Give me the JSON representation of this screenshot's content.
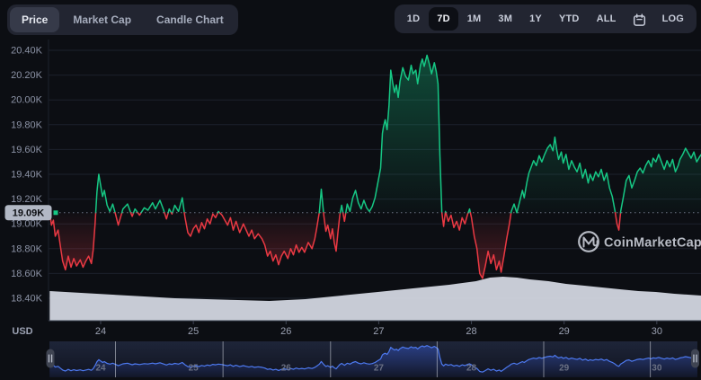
{
  "header": {
    "chart_tabs": [
      {
        "label": "Price",
        "active": true
      },
      {
        "label": "Market Cap",
        "active": false
      },
      {
        "label": "Candle Chart",
        "active": false
      }
    ],
    "range_buttons": [
      {
        "label": "1D",
        "active": false
      },
      {
        "label": "7D",
        "active": true
      },
      {
        "label": "1M",
        "active": false
      },
      {
        "label": "3M",
        "active": false
      },
      {
        "label": "1Y",
        "active": false
      },
      {
        "label": "YTD",
        "active": false
      },
      {
        "label": "ALL",
        "active": false
      }
    ],
    "log_label": "LOG"
  },
  "watermark": {
    "brand": "CoinMarketCap"
  },
  "colors": {
    "background": "#0c0e13",
    "panel": "#222531",
    "grid": "#1d212c",
    "axis_label": "#8c93a6",
    "date_label": "#9ba1b2",
    "up": "#16c784",
    "down": "#ea3943",
    "reference_dotted": "#7e859a",
    "badge_bg": "#b2b8c5",
    "badge_text": "#0b0d11",
    "volume_area": "#d2d6df",
    "plot_border": "#3e4453",
    "nav_line": "#4d79ef",
    "nav_fill": "#3d66f5",
    "nav_bg_top": "#1e2539",
    "nav_bg_bottom": "#10131f",
    "nav_separator": "rgba(227,231,240,0.5)",
    "nav_label": "#6b7184",
    "handle_bg": "#3f4452",
    "handle_glyph": "#b9bfcc",
    "watermark": "#c6cad3"
  },
  "chart_data": {
    "type": "line",
    "title": "",
    "currency_label": "USD",
    "legend": "none",
    "grid": "horizontal only",
    "y_axis": {
      "unit": "K USD",
      "tick_labels": [
        "20.40K",
        "20.20K",
        "20.00K",
        "19.80K",
        "19.60K",
        "19.40K",
        "19.20K",
        "19.00K",
        "18.80K",
        "18.60K",
        "18.40K"
      ],
      "tick_values": [
        20.4,
        20.2,
        20.0,
        19.8,
        19.6,
        19.4,
        19.2,
        19.0,
        18.8,
        18.6,
        18.4
      ],
      "range": [
        18.4,
        20.4
      ]
    },
    "x_axis": {
      "tick_labels": [
        "24",
        "25",
        "26",
        "27",
        "28",
        "29",
        "30"
      ],
      "tick_days": [
        24,
        25,
        26,
        27,
        28,
        29,
        30
      ],
      "range_days": [
        23.45,
        30.48
      ]
    },
    "reference": {
      "value": 19.09,
      "label": "19.09K"
    },
    "price_series": {
      "name": "Price (7D)",
      "color_above": "#16c784",
      "color_below": "#ea3943",
      "points": [
        [
          23.45,
          19.09
        ],
        [
          23.47,
          18.99
        ],
        [
          23.49,
          19.03
        ],
        [
          23.51,
          18.9
        ],
        [
          23.54,
          18.95
        ],
        [
          23.57,
          18.8
        ],
        [
          23.59,
          18.7
        ],
        [
          23.62,
          18.63
        ],
        [
          23.65,
          18.74
        ],
        [
          23.68,
          18.65
        ],
        [
          23.71,
          18.72
        ],
        [
          23.74,
          18.66
        ],
        [
          23.78,
          18.71
        ],
        [
          23.81,
          18.65
        ],
        [
          23.84,
          18.7
        ],
        [
          23.87,
          18.74
        ],
        [
          23.9,
          18.68
        ],
        [
          23.92,
          18.79
        ],
        [
          23.94,
          19.0
        ],
        [
          23.96,
          19.26
        ],
        [
          23.98,
          19.4
        ],
        [
          24.0,
          19.31
        ],
        [
          24.02,
          19.22
        ],
        [
          24.04,
          19.27
        ],
        [
          24.07,
          19.15
        ],
        [
          24.1,
          19.1
        ],
        [
          24.13,
          19.16
        ],
        [
          24.16,
          19.08
        ],
        [
          24.19,
          18.99
        ],
        [
          24.24,
          19.12
        ],
        [
          24.29,
          19.16
        ],
        [
          24.34,
          19.06
        ],
        [
          24.37,
          19.12
        ],
        [
          24.42,
          19.07
        ],
        [
          24.47,
          19.13
        ],
        [
          24.51,
          19.11
        ],
        [
          24.56,
          19.17
        ],
        [
          24.59,
          19.12
        ],
        [
          24.64,
          19.19
        ],
        [
          24.68,
          19.11
        ],
        [
          24.71,
          19.04
        ],
        [
          24.74,
          19.12
        ],
        [
          24.77,
          19.08
        ],
        [
          24.8,
          19.15
        ],
        [
          24.84,
          19.1
        ],
        [
          24.88,
          19.21
        ],
        [
          24.91,
          19.05
        ],
        [
          24.94,
          18.93
        ],
        [
          24.97,
          18.9
        ],
        [
          25.0,
          18.96
        ],
        [
          25.03,
          18.99
        ],
        [
          25.06,
          18.93
        ],
        [
          25.09,
          19.01
        ],
        [
          25.12,
          18.96
        ],
        [
          25.15,
          19.04
        ],
        [
          25.18,
          19.0
        ],
        [
          25.21,
          19.08
        ],
        [
          25.24,
          19.05
        ],
        [
          25.27,
          19.1
        ],
        [
          25.31,
          19.07
        ],
        [
          25.34,
          19.03
        ],
        [
          25.37,
          18.99
        ],
        [
          25.4,
          19.05
        ],
        [
          25.43,
          18.95
        ],
        [
          25.46,
          19.02
        ],
        [
          25.5,
          18.93
        ],
        [
          25.54,
          19.0
        ],
        [
          25.57,
          18.95
        ],
        [
          25.6,
          18.9
        ],
        [
          25.63,
          18.95
        ],
        [
          25.66,
          18.88
        ],
        [
          25.7,
          18.92
        ],
        [
          25.74,
          18.88
        ],
        [
          25.77,
          18.83
        ],
        [
          25.8,
          18.74
        ],
        [
          25.83,
          18.78
        ],
        [
          25.86,
          18.7
        ],
        [
          25.89,
          18.75
        ],
        [
          25.92,
          18.67
        ],
        [
          25.95,
          18.74
        ],
        [
          25.98,
          18.78
        ],
        [
          26.02,
          18.72
        ],
        [
          26.05,
          18.8
        ],
        [
          26.08,
          18.75
        ],
        [
          26.11,
          18.83
        ],
        [
          26.14,
          18.77
        ],
        [
          26.17,
          18.81
        ],
        [
          26.2,
          18.77
        ],
        [
          26.24,
          18.85
        ],
        [
          26.28,
          18.8
        ],
        [
          26.31,
          18.88
        ],
        [
          26.33,
          18.96
        ],
        [
          26.36,
          19.1
        ],
        [
          26.38,
          19.28
        ],
        [
          26.41,
          19.05
        ],
        [
          26.43,
          18.94
        ],
        [
          26.45,
          18.99
        ],
        [
          26.48,
          18.88
        ],
        [
          26.5,
          18.96
        ],
        [
          26.52,
          18.85
        ],
        [
          26.54,
          18.78
        ],
        [
          26.56,
          18.93
        ],
        [
          26.58,
          19.07
        ],
        [
          26.6,
          19.15
        ],
        [
          26.63,
          19.02
        ],
        [
          26.66,
          19.16
        ],
        [
          26.69,
          19.1
        ],
        [
          26.72,
          19.21
        ],
        [
          26.75,
          19.27
        ],
        [
          26.78,
          19.17
        ],
        [
          26.81,
          19.12
        ],
        [
          26.84,
          19.19
        ],
        [
          26.87,
          19.13
        ],
        [
          26.9,
          19.1
        ],
        [
          26.93,
          19.14
        ],
        [
          26.96,
          19.21
        ],
        [
          26.99,
          19.33
        ],
        [
          27.02,
          19.45
        ],
        [
          27.04,
          19.73
        ],
        [
          27.05,
          19.78
        ],
        [
          27.07,
          19.84
        ],
        [
          27.09,
          19.76
        ],
        [
          27.11,
          19.95
        ],
        [
          27.13,
          20.24
        ],
        [
          27.15,
          20.14
        ],
        [
          27.17,
          20.06
        ],
        [
          27.19,
          20.12
        ],
        [
          27.21,
          20.02
        ],
        [
          27.23,
          20.15
        ],
        [
          27.26,
          20.26
        ],
        [
          27.29,
          20.19
        ],
        [
          27.32,
          20.16
        ],
        [
          27.35,
          20.28
        ],
        [
          27.37,
          20.21
        ],
        [
          27.4,
          20.24
        ],
        [
          27.42,
          20.13
        ],
        [
          27.45,
          20.28
        ],
        [
          27.47,
          20.33
        ],
        [
          27.49,
          20.27
        ],
        [
          27.52,
          20.36
        ],
        [
          27.55,
          20.28
        ],
        [
          27.57,
          20.21
        ],
        [
          27.6,
          20.3
        ],
        [
          27.62,
          20.23
        ],
        [
          27.64,
          20.13
        ],
        [
          27.66,
          19.55
        ],
        [
          27.68,
          19.1
        ],
        [
          27.7,
          18.98
        ],
        [
          27.72,
          19.1
        ],
        [
          27.75,
          19.02
        ],
        [
          27.78,
          19.07
        ],
        [
          27.81,
          18.97
        ],
        [
          27.84,
          19.02
        ],
        [
          27.87,
          18.95
        ],
        [
          27.9,
          19.05
        ],
        [
          27.93,
          19.0
        ],
        [
          27.96,
          19.08
        ],
        [
          27.98,
          19.12
        ],
        [
          28.0,
          19.05
        ],
        [
          28.03,
          18.9
        ],
        [
          28.06,
          18.8
        ],
        [
          28.09,
          18.6
        ],
        [
          28.12,
          18.56
        ],
        [
          28.15,
          18.66
        ],
        [
          28.18,
          18.78
        ],
        [
          28.21,
          18.68
        ],
        [
          28.24,
          18.75
        ],
        [
          28.27,
          18.63
        ],
        [
          28.3,
          18.7
        ],
        [
          28.32,
          18.61
        ],
        [
          28.35,
          18.74
        ],
        [
          28.38,
          18.88
        ],
        [
          28.41,
          19.0
        ],
        [
          28.43,
          19.1
        ],
        [
          28.46,
          19.16
        ],
        [
          28.49,
          19.09
        ],
        [
          28.52,
          19.18
        ],
        [
          28.55,
          19.27
        ],
        [
          28.57,
          19.21
        ],
        [
          28.6,
          19.34
        ],
        [
          28.62,
          19.41
        ],
        [
          28.64,
          19.45
        ],
        [
          28.67,
          19.51
        ],
        [
          28.7,
          19.47
        ],
        [
          28.73,
          19.55
        ],
        [
          28.76,
          19.5
        ],
        [
          28.79,
          19.56
        ],
        [
          28.82,
          19.61
        ],
        [
          28.85,
          19.64
        ],
        [
          28.88,
          19.59
        ],
        [
          28.9,
          19.7
        ],
        [
          28.92,
          19.6
        ],
        [
          28.94,
          19.52
        ],
        [
          28.97,
          19.58
        ],
        [
          28.99,
          19.49
        ],
        [
          29.02,
          19.56
        ],
        [
          29.05,
          19.44
        ],
        [
          29.08,
          19.51
        ],
        [
          29.11,
          19.46
        ],
        [
          29.14,
          19.42
        ],
        [
          29.17,
          19.49
        ],
        [
          29.2,
          19.37
        ],
        [
          29.23,
          19.44
        ],
        [
          29.26,
          19.33
        ],
        [
          29.28,
          19.4
        ],
        [
          29.31,
          19.35
        ],
        [
          29.34,
          19.42
        ],
        [
          29.37,
          19.38
        ],
        [
          29.4,
          19.44
        ],
        [
          29.43,
          19.35
        ],
        [
          29.46,
          19.41
        ],
        [
          29.49,
          19.29
        ],
        [
          29.52,
          19.22
        ],
        [
          29.55,
          19.1
        ],
        [
          29.57,
          19.0
        ],
        [
          29.59,
          18.95
        ],
        [
          29.61,
          19.1
        ],
        [
          29.64,
          19.22
        ],
        [
          29.67,
          19.35
        ],
        [
          29.7,
          19.39
        ],
        [
          29.73,
          19.29
        ],
        [
          29.76,
          19.35
        ],
        [
          29.79,
          19.42
        ],
        [
          29.82,
          19.45
        ],
        [
          29.85,
          19.41
        ],
        [
          29.88,
          19.47
        ],
        [
          29.91,
          19.51
        ],
        [
          29.94,
          19.46
        ],
        [
          29.96,
          19.53
        ],
        [
          29.99,
          19.5
        ],
        [
          30.02,
          19.56
        ],
        [
          30.05,
          19.5
        ],
        [
          30.08,
          19.44
        ],
        [
          30.11,
          19.51
        ],
        [
          30.14,
          19.46
        ],
        [
          30.17,
          19.52
        ],
        [
          30.2,
          19.42
        ],
        [
          30.23,
          19.47
        ],
        [
          30.25,
          19.52
        ],
        [
          30.28,
          19.56
        ],
        [
          30.31,
          19.61
        ],
        [
          30.34,
          19.57
        ],
        [
          30.37,
          19.53
        ],
        [
          30.4,
          19.58
        ],
        [
          30.43,
          19.5
        ],
        [
          30.46,
          19.54
        ],
        [
          30.48,
          19.56
        ]
      ]
    },
    "volume_area": {
      "name": "volume profile area (unlabeled, relative height)",
      "points": [
        [
          23.45,
          33
        ],
        [
          23.79,
          31
        ],
        [
          24.13,
          29
        ],
        [
          24.47,
          27
        ],
        [
          24.8,
          25
        ],
        [
          25.14,
          24
        ],
        [
          25.48,
          23
        ],
        [
          25.82,
          22
        ],
        [
          26.21,
          24
        ],
        [
          26.6,
          28
        ],
        [
          26.99,
          32
        ],
        [
          27.37,
          36
        ],
        [
          27.76,
          40
        ],
        [
          28.05,
          44
        ],
        [
          28.2,
          48
        ],
        [
          28.34,
          49
        ],
        [
          28.49,
          48
        ],
        [
          28.63,
          46
        ],
        [
          28.83,
          44
        ],
        [
          29.02,
          41
        ],
        [
          29.22,
          39
        ],
        [
          29.41,
          37
        ],
        [
          29.6,
          35
        ],
        [
          29.8,
          33
        ],
        [
          29.99,
          32
        ],
        [
          30.19,
          30
        ],
        [
          30.48,
          28
        ]
      ]
    },
    "navigator": {
      "labels": [
        "24",
        "25",
        "26",
        "27",
        "28",
        "29",
        "30"
      ],
      "separator_days": [
        24.16,
        25.32,
        26.48,
        27.63,
        28.78,
        29.93
      ]
    }
  }
}
